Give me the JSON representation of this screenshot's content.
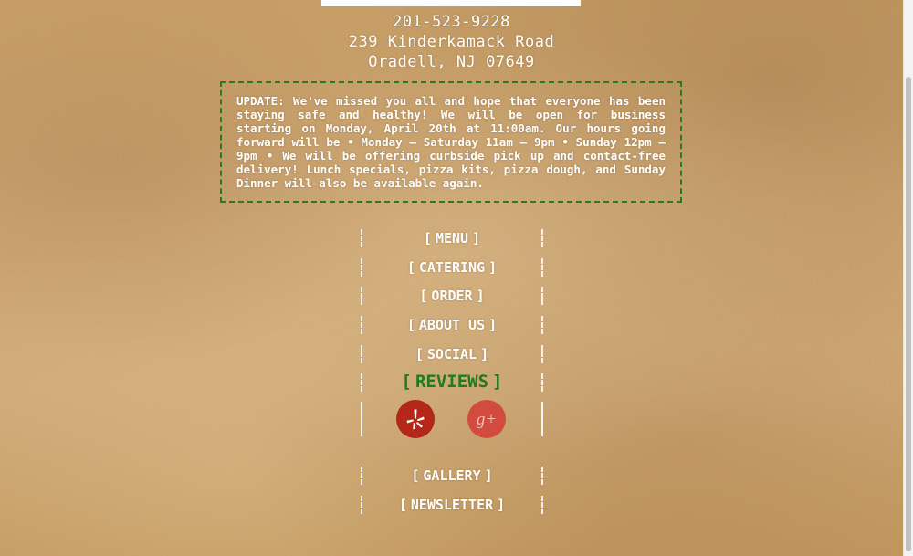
{
  "contact": {
    "phone": "201-523-9228",
    "street": "239 Kinderkamack Road",
    "city": "Oradell, NJ 07649"
  },
  "update": {
    "text": "UPDATE: We've missed you all and hope that everyone has been staying safe and healthy! We will be open for business starting on Monday, April 20th at 11:00am. Our hours going forward will be • Monday – Saturday 11am – 9pm • Sunday 12pm – 9pm • We will be offering curbside pick up and contact-free delivery! Lunch specials, pizza kits, pizza dough, and Sunday Dinner will also be available again."
  },
  "nav": {
    "bracket_open": "[",
    "bracket_close": "]",
    "menu": "MENU",
    "catering": "CATERING",
    "order": "ORDER",
    "about": "ABOUT US",
    "social": "SOCIAL",
    "reviews": "REVIEWS",
    "gallery": "GALLERY",
    "newsletter": "NEWSLETTER"
  },
  "social": {
    "yelp_icon": "yelp-icon",
    "gplus_icon": "google-plus-icon",
    "gplus_glyph": "g+"
  },
  "colors": {
    "accent_green": "#217a1b",
    "yelp_red": "#b52718",
    "gplus_red": "#d24b3e"
  }
}
